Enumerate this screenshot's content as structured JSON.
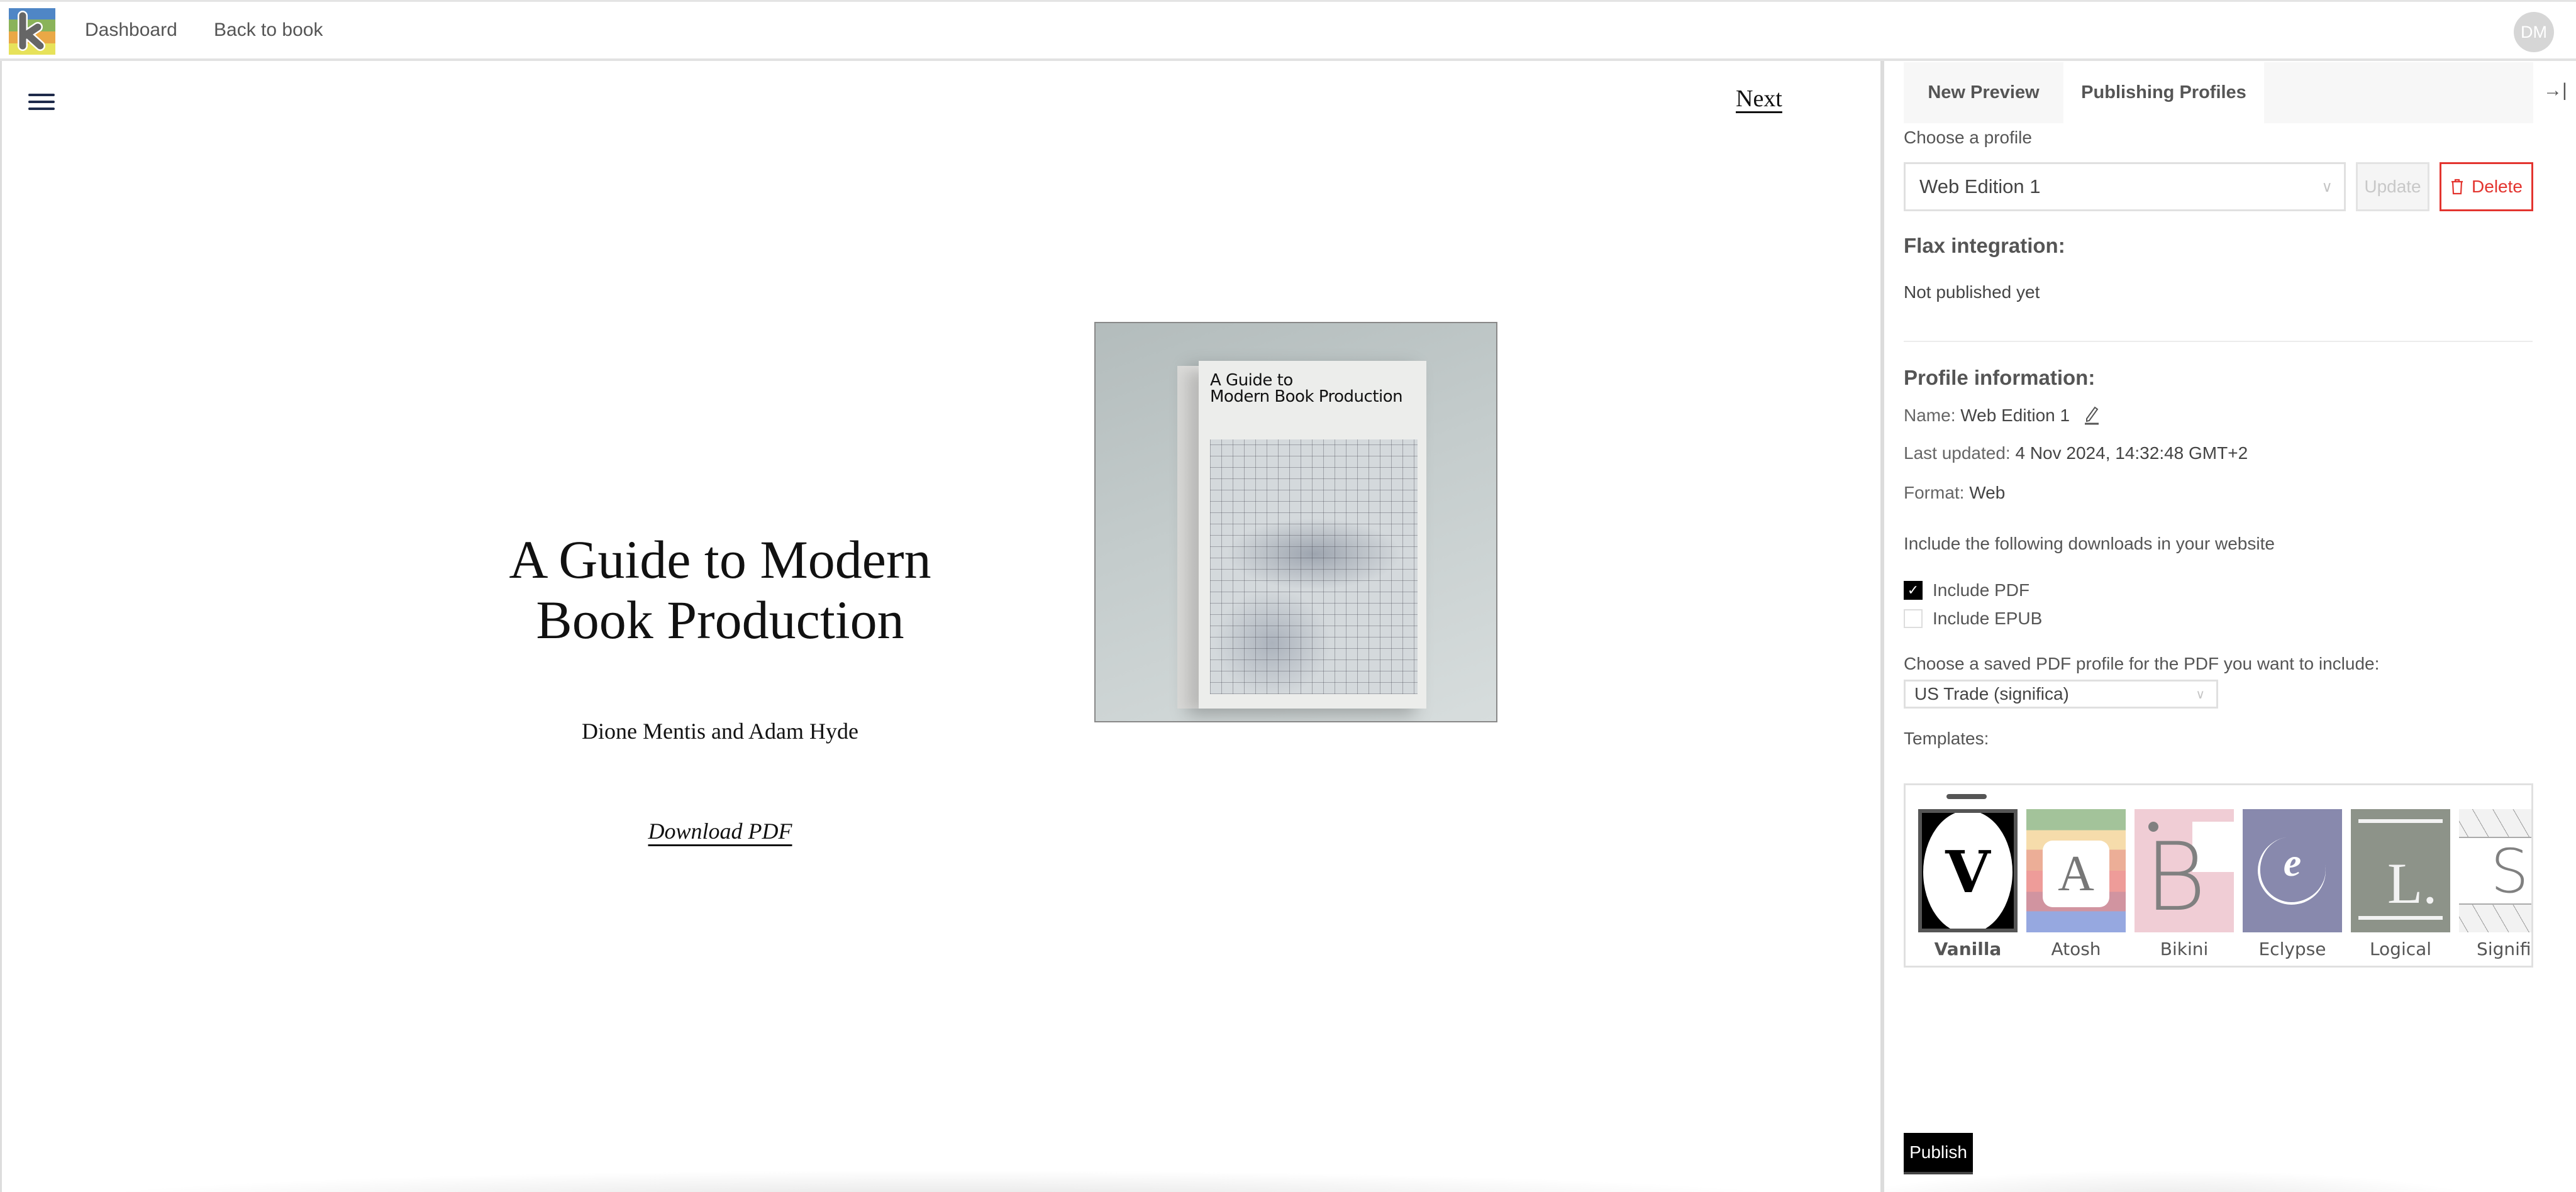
{
  "header": {
    "logo_alt": "Ketida logo",
    "nav": [
      {
        "label": "Dashboard"
      },
      {
        "label": "Back to book"
      }
    ],
    "avatar_initials": "DM"
  },
  "preview": {
    "menu_icon": "hamburger-icon",
    "next_label": "Next",
    "book_title_line1": "A Guide to Modern",
    "book_title_line2": "Book Production",
    "authors": "Dione Mentis and Adam Hyde",
    "download_label": "Download PDF",
    "cover": {
      "title_line1": "A Guide to",
      "title_line2": "Modern Book Production"
    }
  },
  "panel": {
    "tabs": [
      {
        "label": "New Preview",
        "active": false
      },
      {
        "label": "Publishing Profiles",
        "active": true
      }
    ],
    "collapse_icon": "→|",
    "choose_profile_label": "Choose a profile",
    "profile_select_value": "Web Edition 1",
    "update_label": "Update",
    "delete_label": "Delete",
    "flax_heading": "Flax integration:",
    "flax_status": "Not published yet",
    "profile_info_heading": "Profile information:",
    "name_key": "Name:",
    "name_value": "Web Edition 1",
    "last_updated_key": "Last updated:",
    "last_updated_value": "4 Nov 2024, 14:32:48 GMT+2",
    "format_key": "Format:",
    "format_value": "Web",
    "downloads_label": "Include the following downloads in your website",
    "include_pdf": {
      "label": "Include PDF",
      "checked": true
    },
    "include_epub": {
      "label": "Include EPUB",
      "checked": false
    },
    "pdf_profile_label": "Choose a saved PDF profile for the PDF you want to include:",
    "pdf_profile_value": "US Trade (significa)",
    "templates_label": "Templates:",
    "templates": [
      {
        "name": "Vanilla",
        "selected": true
      },
      {
        "name": "Atosh",
        "selected": false
      },
      {
        "name": "Bikini",
        "selected": false
      },
      {
        "name": "Eclypse",
        "selected": false
      },
      {
        "name": "Logical",
        "selected": false
      },
      {
        "name": "Significa",
        "selected": false,
        "visible_label": "Signific"
      }
    ],
    "publish_label": "Publish"
  },
  "colors": {
    "delete_red": "#e3342f",
    "publish_black": "#000000",
    "logo_blue": "#4f86c6",
    "logo_green": "#8ab35a",
    "logo_orange": "#eaa846",
    "logo_yellow": "#e7e25a"
  }
}
